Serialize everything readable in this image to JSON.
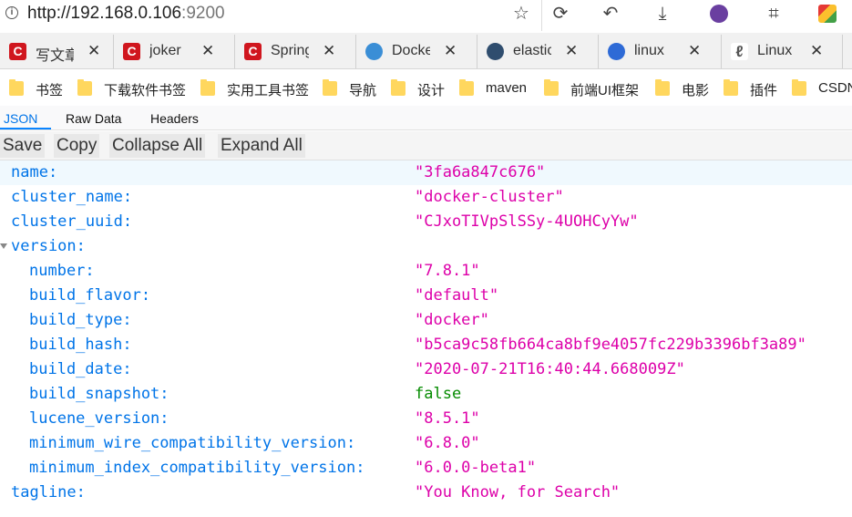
{
  "address": {
    "host": "http://192.168.0.106",
    "port": ":9200"
  },
  "tabs": [
    {
      "title": "写文章",
      "fav": "C",
      "fav_color": "#d0161e"
    },
    {
      "title": "joker",
      "fav": "C",
      "fav_color": "#d0161e"
    },
    {
      "title": "Spring",
      "fav": "C",
      "fav_color": "#d0161e"
    },
    {
      "title": "Docker",
      "fav": "🐳",
      "fav_color": "#3a8ed6"
    },
    {
      "title": "elastic",
      "fav": "◉",
      "fav_color": "#2f4d6e"
    },
    {
      "title": "linux",
      "fav": "🐾",
      "fav_color": "#2e6ad6"
    },
    {
      "title": "Linux",
      "fav": "ℓ",
      "fav_color": "#555555"
    }
  ],
  "bookmarks": [
    "书签",
    "下载软件书签",
    "实用工具书签",
    "导航",
    "设计",
    "maven",
    "前端UI框架",
    "电影",
    "插件",
    "CSDN"
  ],
  "viewer": {
    "tabs": [
      "JSON",
      "Raw Data",
      "Headers"
    ],
    "actions": [
      "Save",
      "Copy",
      "Collapse All",
      "Expand All"
    ]
  },
  "json_rows": [
    {
      "key": "name:",
      "value": "\"3fa6a847c676\"",
      "type": "str"
    },
    {
      "key": "cluster_name:",
      "value": "\"docker-cluster\"",
      "type": "str"
    },
    {
      "key": "cluster_uuid:",
      "value": "\"CJxoTIVpSlSSy-4UOHCyYw\"",
      "type": "str"
    },
    {
      "key": "version:",
      "value": "",
      "type": "obj"
    },
    {
      "key": "number:",
      "value": "\"7.8.1\"",
      "type": "str"
    },
    {
      "key": "build_flavor:",
      "value": "\"default\"",
      "type": "str"
    },
    {
      "key": "build_type:",
      "value": "\"docker\"",
      "type": "str"
    },
    {
      "key": "build_hash:",
      "value": "\"b5ca9c58fb664ca8bf9e4057fc229b3396bf3a89\"",
      "type": "str"
    },
    {
      "key": "build_date:",
      "value": "\"2020-07-21T16:40:44.668009Z\"",
      "type": "str"
    },
    {
      "key": "build_snapshot:",
      "value": "false",
      "type": "bool"
    },
    {
      "key": "lucene_version:",
      "value": "\"8.5.1\"",
      "type": "str"
    },
    {
      "key": "minimum_wire_compatibility_version:",
      "value": "\"6.8.0\"",
      "type": "str"
    },
    {
      "key": "minimum_index_compatibility_version:",
      "value": "\"6.0.0-beta1\"",
      "type": "str"
    },
    {
      "key": "tagline:",
      "value": "\"You Know, for Search\"",
      "type": "str"
    }
  ]
}
